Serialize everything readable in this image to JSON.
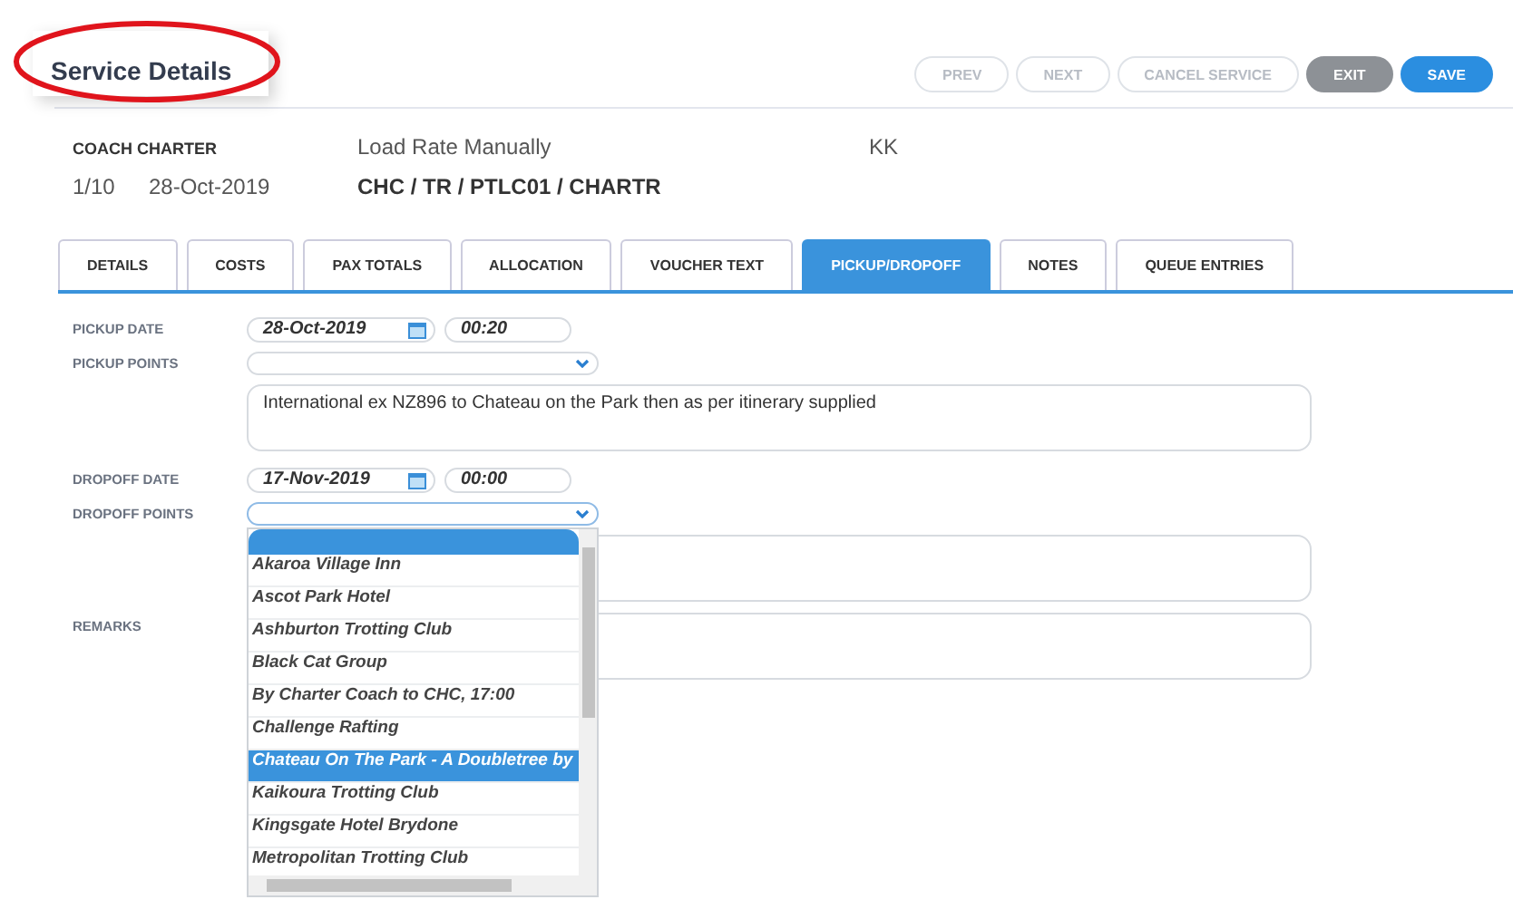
{
  "header": {
    "title": "Service Details",
    "buttons": [
      {
        "label": "PREV",
        "kind": "outline",
        "disabled": true
      },
      {
        "label": "NEXT",
        "kind": "outline",
        "disabled": true
      },
      {
        "label": "CANCEL SERVICE",
        "kind": "outline",
        "disabled": true
      },
      {
        "label": "EXIT",
        "kind": "grey",
        "disabled": false
      },
      {
        "label": "SAVE",
        "kind": "primary",
        "disabled": false
      }
    ]
  },
  "summary": {
    "service_type": "COACH CHARTER",
    "rate": "Load Rate Manually",
    "code": "KK",
    "sequence": "1/10",
    "date": "28-Oct-2019",
    "route": "CHC / TR / PTLC01 / CHARTR"
  },
  "tabs": [
    {
      "label": "DETAILS",
      "selected": false
    },
    {
      "label": "COSTS",
      "selected": false
    },
    {
      "label": "PAX TOTALS",
      "selected": false
    },
    {
      "label": "ALLOCATION",
      "selected": false
    },
    {
      "label": "VOUCHER TEXT",
      "selected": false
    },
    {
      "label": "PICKUP/DROPOFF",
      "selected": true
    },
    {
      "label": "NOTES",
      "selected": false
    },
    {
      "label": "QUEUE ENTRIES",
      "selected": false
    }
  ],
  "pickup": {
    "date_label": "PICKUP DATE",
    "date": "28-Oct-2019",
    "time": "00:20",
    "points_label": "PICKUP POINTS",
    "notes": "International ex NZ896 to Chateau on the Park then as per itinerary supplied"
  },
  "dropoff": {
    "date_label": "DROPOFF DATE",
    "date": "17-Nov-2019",
    "time": "00:00",
    "points_label": "DROPOFF POINTS"
  },
  "remarks_label": "REMARKS",
  "dropdown_options": [
    {
      "label": "Akaroa Village Inn",
      "selected": false
    },
    {
      "label": "Ascot Park Hotel",
      "selected": false
    },
    {
      "label": "Ashburton Trotting Club",
      "selected": false
    },
    {
      "label": "Black Cat Group",
      "selected": false
    },
    {
      "label": "By Charter Coach to CHC, 17:00",
      "selected": false
    },
    {
      "label": "Challenge Rafting",
      "selected": false
    },
    {
      "label": "Chateau On The Park - A Doubletree by",
      "selected": true
    },
    {
      "label": "Kaikoura Trotting Club",
      "selected": false
    },
    {
      "label": "Kingsgate Hotel Brydone",
      "selected": false
    },
    {
      "label": "Metropolitan Trotting Club",
      "selected": false
    }
  ]
}
